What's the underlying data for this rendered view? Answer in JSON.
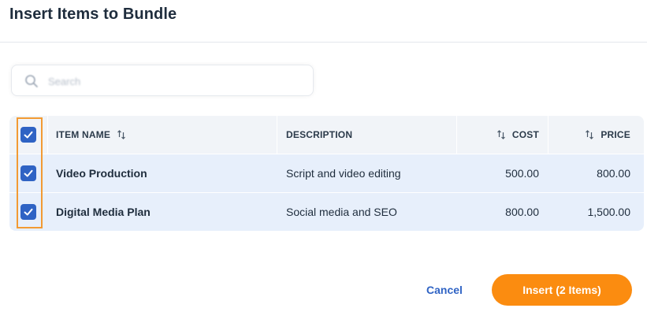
{
  "dialog": {
    "title": "Insert Items to Bundle"
  },
  "search": {
    "placeholder": "Search",
    "value": ""
  },
  "table": {
    "columns": {
      "item_name": "ITEM NAME",
      "description": "DESCRIPTION",
      "cost": "COST",
      "price": "PRICE"
    },
    "select_all_checked": true,
    "rows": [
      {
        "checked": true,
        "name": "Video Production",
        "description": "Script and video editing",
        "cost": "500.00",
        "price": "800.00"
      },
      {
        "checked": true,
        "name": "Digital Media Plan",
        "description": "Social media and SEO",
        "cost": "800.00",
        "price": "1,500.00"
      }
    ]
  },
  "actions": {
    "cancel_label": "Cancel",
    "insert_label": "Insert (2 Items)"
  },
  "colors": {
    "accent": "#fb8c10",
    "checkbox": "#2f63c4",
    "link": "#2f63c4",
    "highlight": "#f29a33",
    "row_bg": "#e7effb"
  },
  "icons": {
    "search": "search-icon",
    "sort": "sort-arrows-icon",
    "check": "check-icon"
  }
}
